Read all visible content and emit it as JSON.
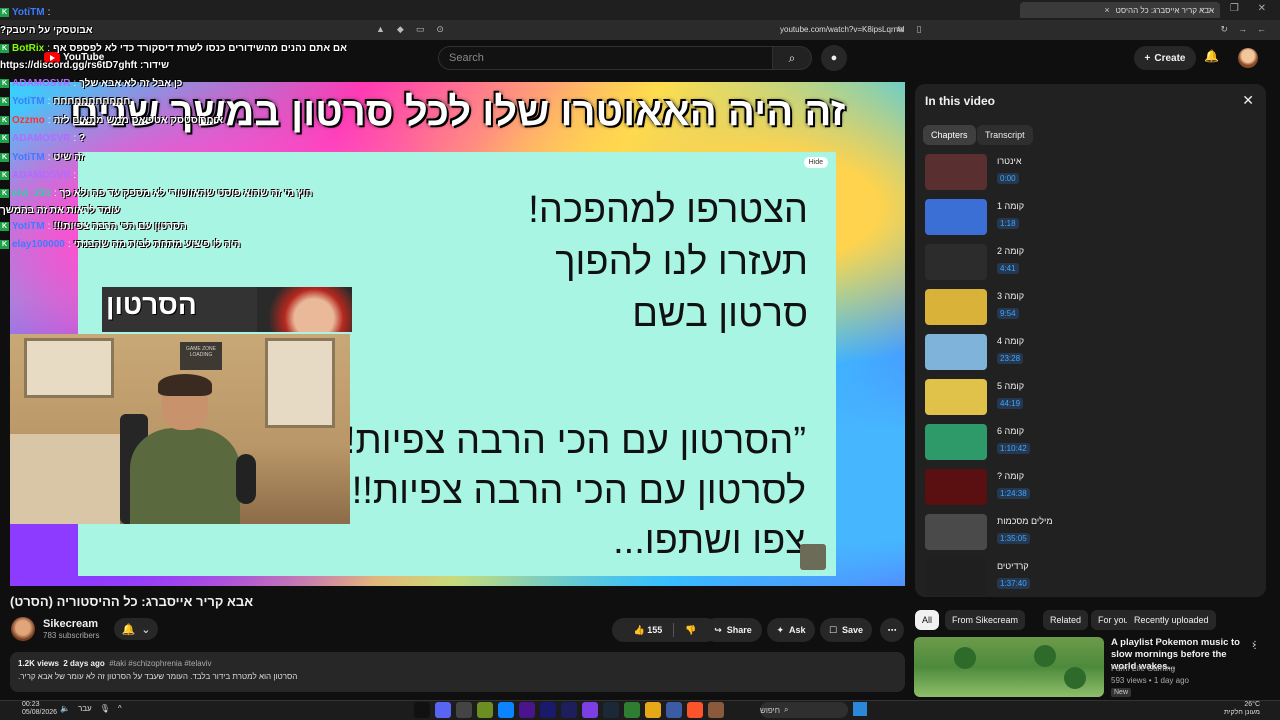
{
  "browser": {
    "tab_title": "אבא קריר אייסברג: כל ההיסט",
    "url": "youtube.com/watch?v=K8ipsLqrnel",
    "new_tab": "+",
    "tab_close": "×",
    "window_controls": "—  ❐  ✕"
  },
  "header": {
    "logo_text": "YouTube",
    "search_placeholder": "Search",
    "create_label": "Create"
  },
  "player": {
    "headline": "זה היה האאוטרו שלו לכל סרטון במשך שנים",
    "hide_label": "Hide",
    "slide_top_lines": [
      "הצטרפו למהפכה!",
      "תעזרו לנו להפוך",
      "סרטון בשם"
    ],
    "slide_bottom_lines": [
      "”הסרטון עם הכי הרבה צפיות!!!",
      "לסרטון עם הכי הרבה צפיות!!!",
      "צפו ושתפו..."
    ],
    "webcam_poster": "GAME ZONE LOADING",
    "mini_cam_title": "הסרטון"
  },
  "chat": [
    {
      "user": "YotiTM",
      "msg": "",
      "color": "#3d7bff"
    },
    {
      "user": "",
      "msg": "אבוטסקי על היטבק?",
      "color": "#ffffff"
    },
    {
      "user": "BotRix",
      "msg": "אם אתם נהנים מהשידורים כנסו לשרת דיסקורד כדי לא לפספס אף",
      "color": "#7fff00"
    },
    {
      "user": "",
      "msg": "שידור: https://discord.gg/rs6tD7ghft",
      "color": "#ffffff"
    },
    {
      "user": "ADAMOSVR",
      "msg": "כן אבל זה לא אבא שלך",
      "color": "#b06cff"
    },
    {
      "user": "YotiTM",
      "msg": "חחחחחחחחחחח",
      "color": "#3d7bff"
    },
    {
      "user": "Ozzmo",
      "msg": "איחרוסטסק אטכיאס ממש מתאים לזה",
      "color": "#ff3030"
    },
    {
      "user": "ADAMOSVR",
      "msg": "?",
      "color": "#b06cff"
    },
    {
      "user": "YotiTM",
      "msg": "זה שיט",
      "color": "#3d7bff"
    },
    {
      "user": "ADAMOSVR",
      "msg": "",
      "color": "#b06cff"
    },
    {
      "user": "eivi_231",
      "msg": "חוץ מי זה שהוא פוסט שהאווטורי לא מספק עד פה ולא כך",
      "color": "#2fd1a0"
    },
    {
      "user": "",
      "msg": "עומד לראות את זה בהמשך",
      "color": "#ffffff"
    },
    {
      "user": "YotiTM",
      "msg": "הסרטון עם הכי הרבה צפיות!!!",
      "color": "#3d7bff"
    },
    {
      "user": "elay100000",
      "msg": "היה לו פיצוע מתחת לבית מה שהבנתי",
      "color": "#3d7bff"
    }
  ],
  "video": {
    "title": "אבא קריר אייסברג: כל ההיסטוריה (הסרט)",
    "channel": "Sikecream",
    "subscribers": "783 subscribers",
    "likes": "155",
    "share_label": "Share",
    "ask_label": "Ask",
    "save_label": "Save",
    "views": "1.2K views",
    "age": "2 days ago",
    "tags": "#taki #schizophrenia #telaviv",
    "description": "הסרטון הוא למטרת בידור בלבד. העומר שעבד על הסרטון זה לא עומר של אבא קריר."
  },
  "panel": {
    "title": "In this video",
    "tabs": [
      "Chapters",
      "Transcript"
    ],
    "chapters": [
      {
        "name": "אינטרו",
        "time": "0:00",
        "color": "#5a2f2f"
      },
      {
        "name": "קומה 1",
        "time": "1:18",
        "color": "#3b6fd6"
      },
      {
        "name": "קומה 2",
        "time": "4:41",
        "color": "#2c2c2c"
      },
      {
        "name": "קומה 3",
        "time": "9:54",
        "color": "#d9b23a"
      },
      {
        "name": "קומה 4",
        "time": "23:28",
        "color": "#7fb3d9"
      },
      {
        "name": "קומה 5",
        "time": "44:19",
        "color": "#e0c24a"
      },
      {
        "name": "קומה 6",
        "time": "1:10:42",
        "color": "#2e9a6a"
      },
      {
        "name": "קומה ?",
        "time": "1:24:38",
        "color": "#5a0f10"
      },
      {
        "name": "מילים מסכמות",
        "time": "1:35:05",
        "color": "#4a4a4a"
      },
      {
        "name": "קרדיטים",
        "time": "1:37:40",
        "color": "#1f1f1f"
      }
    ]
  },
  "filters": [
    "All",
    "From Sikecream",
    "Related",
    "For you",
    "Recently uploaded"
  ],
  "recommendation": {
    "title": "A playlist Pokemon music to slow mornings before the world wakes...",
    "channel": "Farm Life Gaming",
    "meta": "593 views • 1 day ago",
    "badge": "New"
  },
  "taskbar": {
    "time": "00:23",
    "date": "05/08/2026",
    "lang": "עבר",
    "search": "חיפוש",
    "weather": "26°C",
    "weather_desc": "מעונן חלקית"
  }
}
